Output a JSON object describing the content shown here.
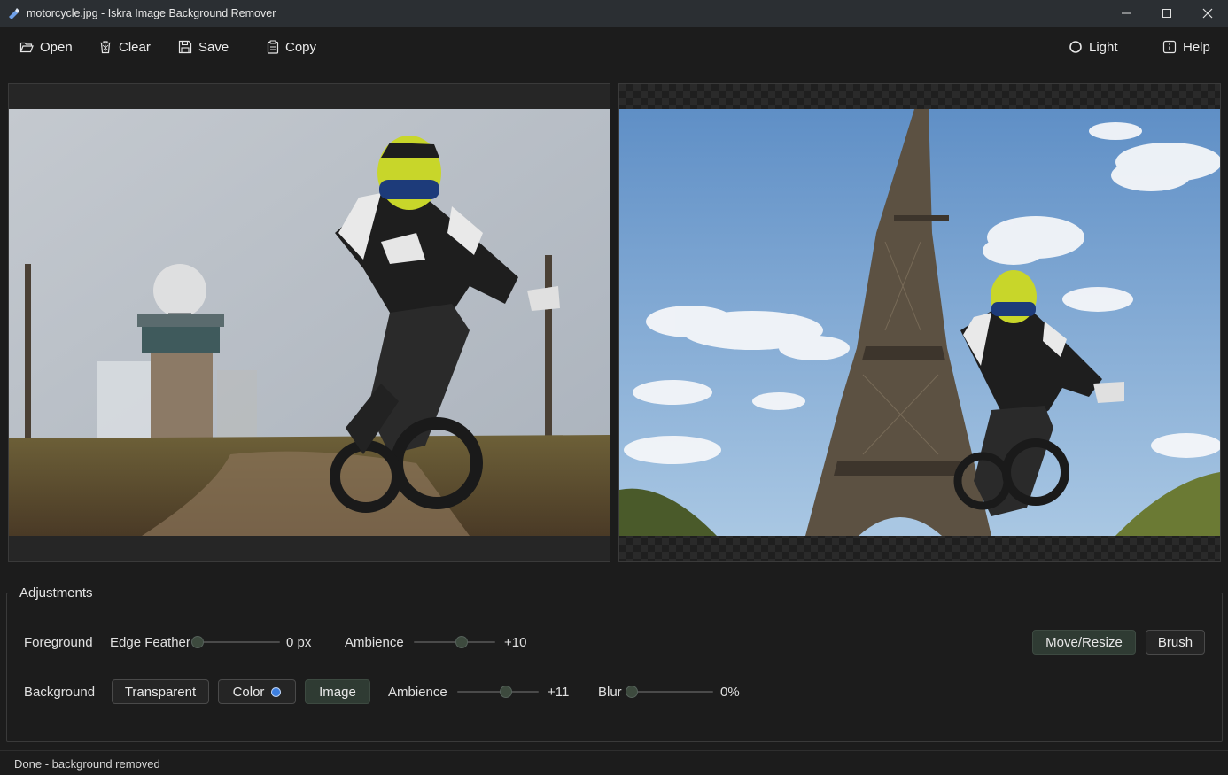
{
  "window": {
    "title": "motorcycle.jpg - Iskra Image Background Remover"
  },
  "toolbar": {
    "open_label": "Open",
    "clear_label": "Clear",
    "save_label": "Save",
    "copy_label": "Copy",
    "theme_label": "Light",
    "help_label": "Help"
  },
  "adjustments": {
    "title": "Adjustments",
    "foreground": {
      "label": "Foreground",
      "edge_feather_label": "Edge Feather",
      "edge_feather_value": "0 px",
      "edge_feather_fraction": 0.0,
      "ambience_label": "Ambience",
      "ambience_value": "+10",
      "ambience_fraction": 0.6
    },
    "background": {
      "label": "Background",
      "transparent_label": "Transparent",
      "color_label": "Color",
      "image_label": "Image",
      "ambience_label": "Ambience",
      "ambience_value": "+11",
      "ambience_fraction": 0.61,
      "blur_label": "Blur",
      "blur_value": "0%",
      "blur_fraction": 0.0
    },
    "modes": {
      "move_resize_label": "Move/Resize",
      "brush_label": "Brush"
    }
  },
  "status": {
    "text": "Done - background removed"
  },
  "colors": {
    "accent_dot": "#3d7fe0",
    "active_button": "#2f3b33"
  }
}
